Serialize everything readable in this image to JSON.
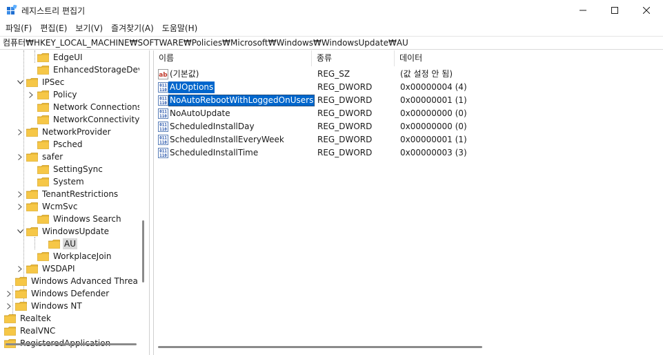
{
  "window": {
    "title": "레지스트리 편집기",
    "icon": "registry-editor-icon",
    "controls": [
      "minimize-icon",
      "maximize-icon",
      "close-icon"
    ]
  },
  "menu": [
    {
      "label": "파일(F)"
    },
    {
      "label": "편집(E)"
    },
    {
      "label": "보기(V)"
    },
    {
      "label": "즐겨찾기(A)"
    },
    {
      "label": "도움말(H)"
    }
  ],
  "address": "컴퓨터₩HKEY_LOCAL_MACHINE₩SOFTWARE₩Policies₩Microsoft₩Windows₩WindowsUpdate₩AU",
  "tree": [
    {
      "label": "EdgeUI",
      "expander": "none"
    },
    {
      "label": "EnhancedStorageDevic",
      "expander": "none"
    },
    {
      "label": "IPSec",
      "expander": "expanded"
    },
    {
      "label": "Policy",
      "expander": "collapsed"
    },
    {
      "label": "Network Connections",
      "expander": "none"
    },
    {
      "label": "NetworkConnectivitySt",
      "expander": "none"
    },
    {
      "label": "NetworkProvider",
      "expander": "collapsed"
    },
    {
      "label": "Psched",
      "expander": "none"
    },
    {
      "label": "safer",
      "expander": "collapsed"
    },
    {
      "label": "SettingSync",
      "expander": "none"
    },
    {
      "label": "System",
      "expander": "none"
    },
    {
      "label": "TenantRestrictions",
      "expander": "collapsed"
    },
    {
      "label": "WcmSvc",
      "expander": "collapsed"
    },
    {
      "label": "Windows Search",
      "expander": "none"
    },
    {
      "label": "WindowsUpdate",
      "expander": "expanded"
    },
    {
      "label": "AU",
      "expander": "none",
      "selected": true
    },
    {
      "label": "WorkplaceJoin",
      "expander": "none"
    },
    {
      "label": "WSDAPI",
      "expander": "collapsed"
    },
    {
      "label": "Windows Advanced Threa",
      "expander": "none"
    },
    {
      "label": "Windows Defender",
      "expander": "collapsed"
    },
    {
      "label": "Windows NT",
      "expander": "collapsed"
    },
    {
      "label": "Realtek",
      "expander": "none"
    },
    {
      "label": "RealVNC",
      "expander": "none"
    },
    {
      "label": "RegisteredApplication",
      "expander": "none"
    }
  ],
  "columns": {
    "name": "이름",
    "type": "종류",
    "data": "데이터"
  },
  "values": [
    {
      "name": "(기본값)",
      "type": "REG_SZ",
      "data": "(값 설정 안 됨)",
      "icon": "string-value-icon",
      "selected": false,
      "focused": false
    },
    {
      "name": "AUOptions",
      "type": "REG_DWORD",
      "data": "0x00000004 (4)",
      "icon": "binary-value-icon",
      "selected": true,
      "focused": false
    },
    {
      "name": "NoAutoRebootWithLoggedOnUsers",
      "type": "REG_DWORD",
      "data": "0x00000001 (1)",
      "icon": "binary-value-icon",
      "selected": true,
      "focused": true
    },
    {
      "name": "NoAutoUpdate",
      "type": "REG_DWORD",
      "data": "0x00000000 (0)",
      "icon": "binary-value-icon",
      "selected": false,
      "focused": false
    },
    {
      "name": "ScheduledInstallDay",
      "type": "REG_DWORD",
      "data": "0x00000000 (0)",
      "icon": "binary-value-icon",
      "selected": false,
      "focused": false
    },
    {
      "name": "ScheduledInstallEveryWeek",
      "type": "REG_DWORD",
      "data": "0x00000001 (1)",
      "icon": "binary-value-icon",
      "selected": false,
      "focused": false
    },
    {
      "name": "ScheduledInstallTime",
      "type": "REG_DWORD",
      "data": "0x00000003 (3)",
      "icon": "binary-value-icon",
      "selected": false,
      "focused": false
    }
  ],
  "colors": {
    "selection": "#0066cc",
    "tree_selection": "#d9d9d9",
    "folder": "#f6c747"
  }
}
